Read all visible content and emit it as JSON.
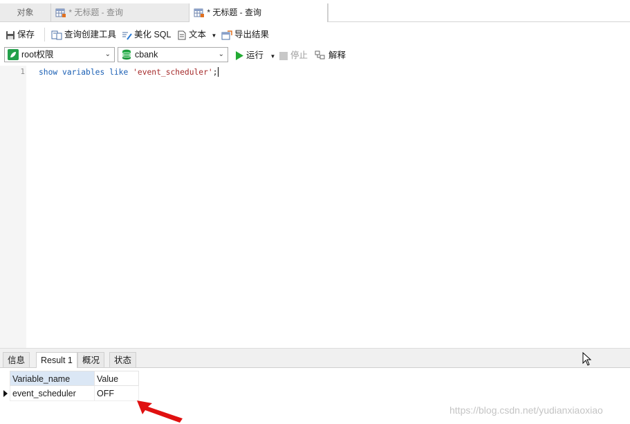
{
  "tabs": {
    "objects": "对象",
    "query1": "* 无标题 - 查询",
    "query2": "* 无标题 - 查询"
  },
  "toolbar": {
    "save": "保存",
    "query_builder": "查询创建工具",
    "beautify": "美化 SQL",
    "text": "文本",
    "export": "导出结果"
  },
  "controls": {
    "connection": "root权限",
    "database": "cbank",
    "run": "运行",
    "stop": "停止",
    "explain": "解释"
  },
  "editor": {
    "line_number": "1",
    "kw1": "show",
    "kw2": "variables",
    "kw3": "like",
    "string": "'event_scheduler'",
    "end": ";"
  },
  "result_tabs": [
    "信息",
    "Result 1",
    "概况",
    "状态"
  ],
  "result": {
    "columns": [
      "Variable_name",
      "Value"
    ],
    "rows": [
      [
        "event_scheduler",
        "OFF"
      ]
    ]
  },
  "watermark": "https://blog.csdn.net/yudianxiaoxiao",
  "colors": {
    "accent_arrow": "#e01010",
    "keyword": "#1a5fb4",
    "string": "#a52a2a",
    "run_green": "#22aa33"
  }
}
